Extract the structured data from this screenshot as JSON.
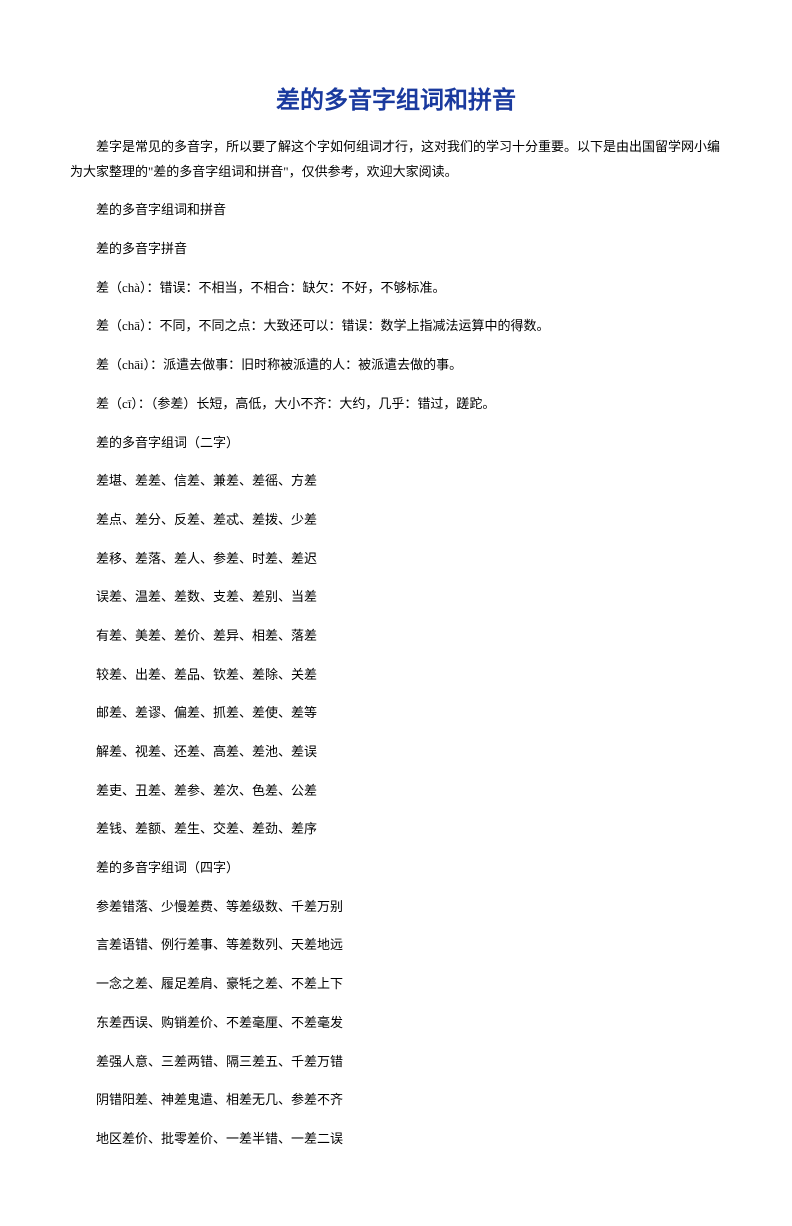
{
  "title": "差的多音字组词和拼音",
  "intro": "差字是常见的多音字，所以要了解这个字如何组词才行，这对我们的学习十分重要。以下是由出国留学网小编为大家整理的\"差的多音字组词和拼音\"，仅供参考，欢迎大家阅读。",
  "lines": [
    "差的多音字组词和拼音",
    "差的多音字拼音",
    "差（chà）：错误：不相当，不相合：缺欠：不好，不够标准。",
    "差（chā）：不同，不同之点：大致还可以：错误：数学上指减法运算中的得数。",
    "差（chāi）：派遣去做事：旧时称被派遣的人：被派遣去做的事。",
    "差（cī）：（参差）长短，高低，大小不齐：大约，几乎：错过，蹉跎。",
    "差的多音字组词（二字）",
    "差堪、差差、信差、兼差、差徭、方差",
    "差点、差分、反差、差忒、差拨、少差",
    "差移、差落、差人、参差、时差、差迟",
    "误差、温差、差数、支差、差别、当差",
    "有差、美差、差价、差异、相差、落差",
    "较差、出差、差品、钦差、差除、关差",
    "邮差、差谬、偏差、抓差、差使、差等",
    "解差、视差、还差、高差、差池、差误",
    "差吏、丑差、差参、差次、色差、公差",
    "差钱、差额、差生、交差、差劲、差序",
    "差的多音字组词（四字）",
    "参差错落、少慢差费、等差级数、千差万别",
    "言差语错、例行差事、等差数列、天差地远",
    "一念之差、履足差肩、豪牦之差、不差上下",
    "东差西误、购销差价、不差毫厘、不差毫发",
    "差强人意、三差两错、隔三差五、千差万错",
    "阴错阳差、神差鬼遣、相差无几、参差不齐",
    "地区差价、批零差价、一差半错、一差二误"
  ]
}
